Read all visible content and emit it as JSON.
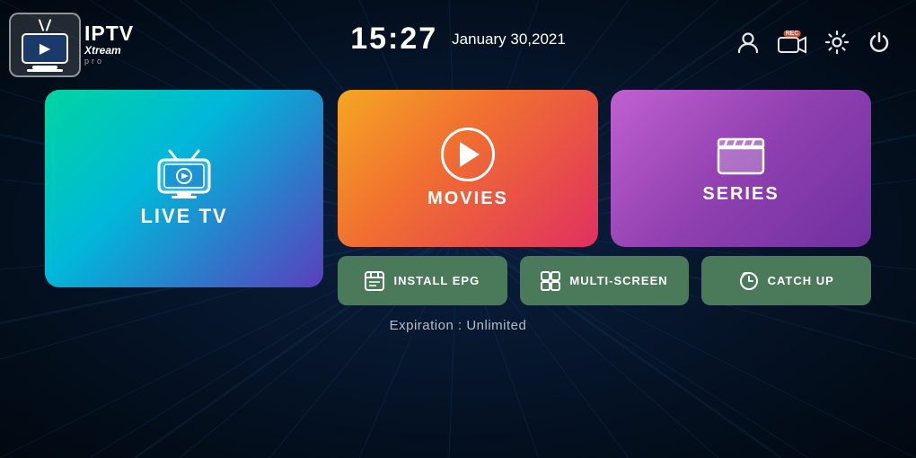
{
  "header": {
    "time": "15:27",
    "date": "January 30,2021",
    "logo_iptv": "IPTV",
    "logo_xtream": "Xtream",
    "logo_pro": "pro"
  },
  "cards": {
    "live_tv": {
      "label": "LIVE TV"
    },
    "movies": {
      "label": "MOVIES"
    },
    "series": {
      "label": "SERIES"
    },
    "install_epg": {
      "label": "INSTALL EPG"
    },
    "multi_screen": {
      "label": "MULTI-SCREEN"
    },
    "catch_up": {
      "label": "CATCH UP"
    }
  },
  "footer": {
    "expiration": "Expiration : Unlimited"
  },
  "icons": {
    "user": "👤",
    "record": "📹",
    "settings": "⚙",
    "power": "⏻"
  }
}
